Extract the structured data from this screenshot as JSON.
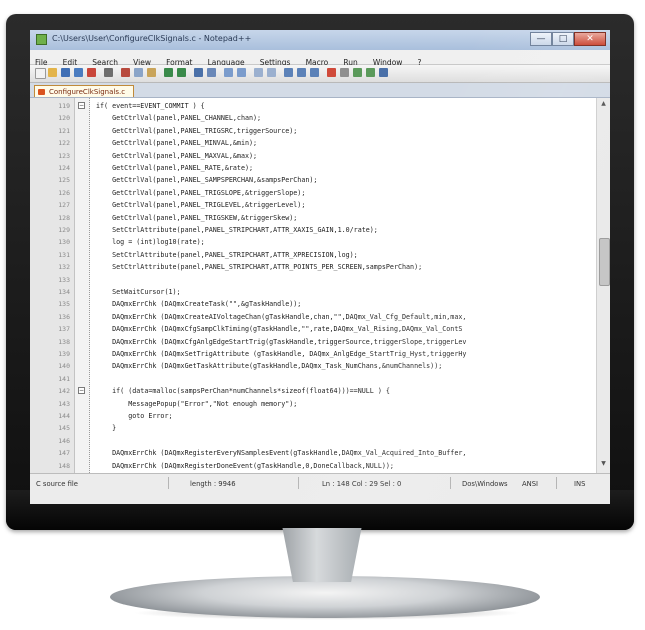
{
  "window": {
    "title": "C:\\Users\\User\\ConfigureClkSignals.c - Notepad++",
    "minimize_glyph": "—",
    "maximize_glyph": "□",
    "close_glyph": "✕"
  },
  "menu": [
    "File",
    "Edit",
    "Search",
    "View",
    "Format",
    "Language",
    "Settings",
    "Macro",
    "Run",
    "Window",
    "?"
  ],
  "tab": {
    "label": "ConfigureClkSignals.c"
  },
  "code_lines": [
    {
      "num": "119",
      "text": "if( event==EVENT_COMMIT ) {"
    },
    {
      "num": "120",
      "text": "    GetCtrlVal(panel,PANEL_CHANNEL,chan);"
    },
    {
      "num": "121",
      "text": "    GetCtrlVal(panel,PANEL_TRIGSRC,triggerSource);"
    },
    {
      "num": "122",
      "text": "    GetCtrlVal(panel,PANEL_MINVAL,&min);"
    },
    {
      "num": "123",
      "text": "    GetCtrlVal(panel,PANEL_MAXVAL,&max);"
    },
    {
      "num": "124",
      "text": "    GetCtrlVal(panel,PANEL_RATE,&rate);"
    },
    {
      "num": "125",
      "text": "    GetCtrlVal(panel,PANEL_SAMPSPERCHAN,&sampsPerChan);"
    },
    {
      "num": "126",
      "text": "    GetCtrlVal(panel,PANEL_TRIGSLOPE,&triggerSlope);"
    },
    {
      "num": "127",
      "text": "    GetCtrlVal(panel,PANEL_TRIGLEVEL,&triggerLevel);"
    },
    {
      "num": "128",
      "text": "    GetCtrlVal(panel,PANEL_TRIGSKEW,&triggerSkew);"
    },
    {
      "num": "129",
      "text": "    SetCtrlAttribute(panel,PANEL_STRIPCHART,ATTR_XAXIS_GAIN,1.0/rate);"
    },
    {
      "num": "130",
      "text": "    log = (int)log10(rate);"
    },
    {
      "num": "131",
      "text": "    SetCtrlAttribute(panel,PANEL_STRIPCHART,ATTR_XPRECISION,log);"
    },
    {
      "num": "132",
      "text": "    SetCtrlAttribute(panel,PANEL_STRIPCHART,ATTR_POINTS_PER_SCREEN,sampsPerChan);"
    },
    {
      "num": "133",
      "text": ""
    },
    {
      "num": "134",
      "text": "    SetWaitCursor(1);"
    },
    {
      "num": "135",
      "text": "    DAQmxErrChk (DAQmxCreateTask(\"\",&gTaskHandle));"
    },
    {
      "num": "136",
      "text": "    DAQmxErrChk (DAQmxCreateAIVoltageChan(gTaskHandle,chan,\"\",DAQmx_Val_Cfg_Default,min,max,"
    },
    {
      "num": "137",
      "text": "    DAQmxErrChk (DAQmxCfgSampClkTiming(gTaskHandle,\"\",rate,DAQmx_Val_Rising,DAQmx_Val_ContS"
    },
    {
      "num": "138",
      "text": "    DAQmxErrChk (DAQmxCfgAnlgEdgeStartTrig(gTaskHandle,triggerSource,triggerSlope,triggerLev"
    },
    {
      "num": "139",
      "text": "    DAQmxErrChk (DAQmxSetTrigAttribute (gTaskHandle, DAQmx_AnlgEdge_StartTrig_Hyst,triggerHy"
    },
    {
      "num": "140",
      "text": "    DAQmxErrChk (DAQmxGetTaskAttribute(gTaskHandle,DAQmx_Task_NumChans,&numChannels));"
    },
    {
      "num": "141",
      "text": ""
    },
    {
      "num": "142",
      "text": "    if( (data=malloc(sampsPerChan*numChannels*sizeof(float64)))==NULL ) {"
    },
    {
      "num": "143",
      "text": "        MessagePopup(\"Error\",\"Not enough memory\");"
    },
    {
      "num": "144",
      "text": "        goto Error;"
    },
    {
      "num": "145",
      "text": "    }"
    },
    {
      "num": "146",
      "text": ""
    },
    {
      "num": "147",
      "text": "    DAQmxErrChk (DAQmxRegisterEveryNSamplesEvent(gTaskHandle,DAQmx_Val_Acquired_Into_Buffer,"
    },
    {
      "num": "148",
      "text": "    DAQmxErrChk (DAQmxRegisterDoneEvent(gTaskHandle,0,DoneCallback,NULL));"
    }
  ],
  "status": {
    "file_type": "C source file",
    "length": "length : 9946",
    "position": "Ln : 148   Col : 29   Sel : 0",
    "eol": "Dos\\Windows",
    "encoding": "ANSI",
    "mode": "INS"
  }
}
